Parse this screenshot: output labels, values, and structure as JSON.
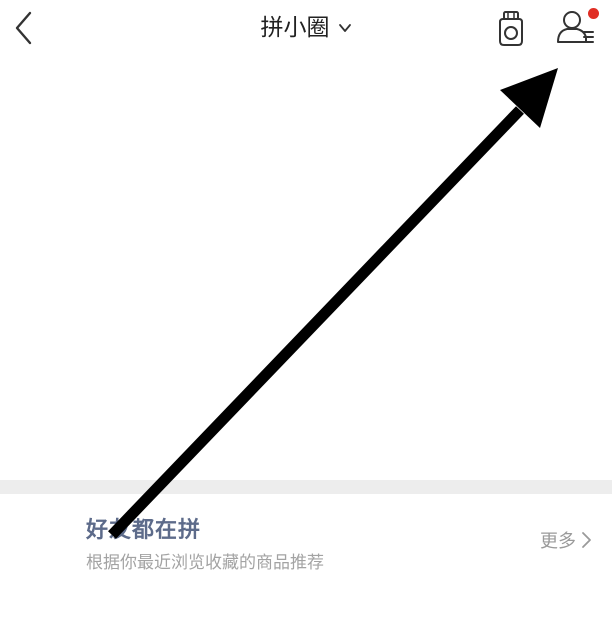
{
  "header": {
    "title": "拼小圈",
    "back_icon": "chevron-left-icon",
    "dropdown_icon": "chevron-down-icon",
    "badge_icon": "medal-badge-icon",
    "profile_icon": "profile-settings-icon",
    "notification_dot_color": "#e02e24"
  },
  "friends_section": {
    "title": "好友都在拼",
    "subtitle": "根据你最近浏览收藏的商品推荐",
    "more_label": "更多",
    "title_color": "#5d6b8a"
  },
  "annotation": {
    "icon": "arrow-annotation",
    "color": "#000000"
  }
}
